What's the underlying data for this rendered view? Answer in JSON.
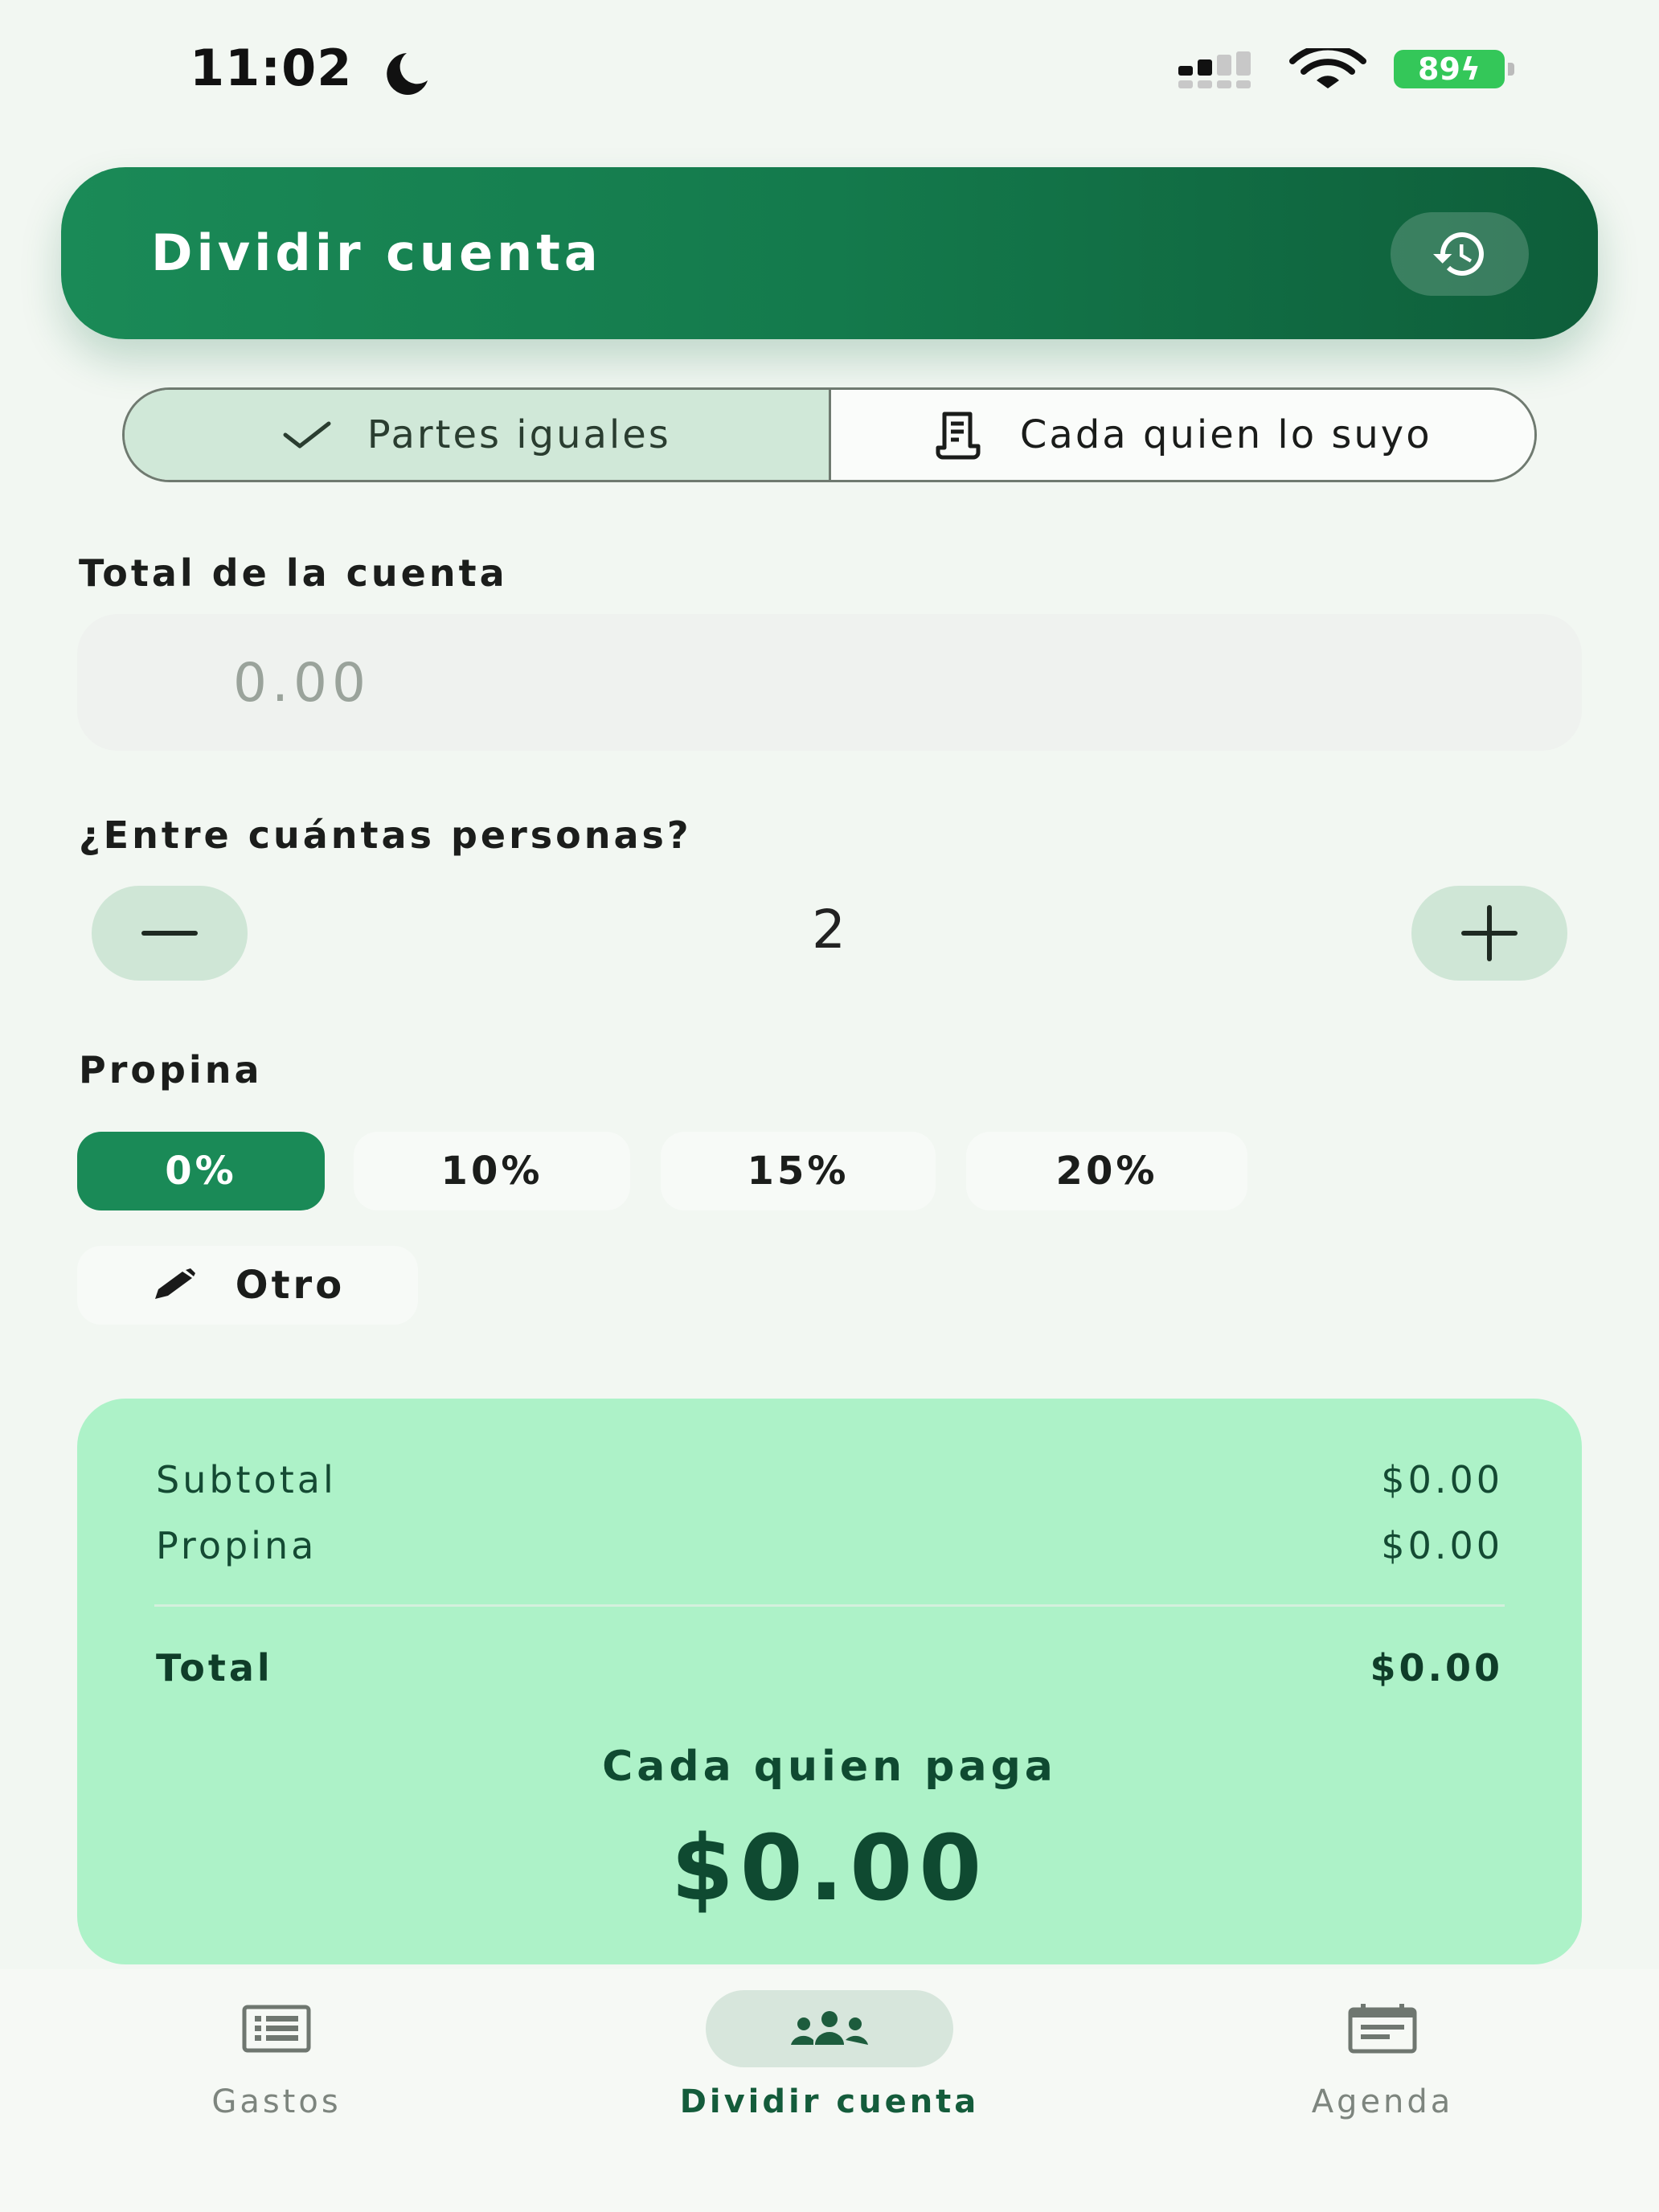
{
  "status_bar": {
    "time": "11:02",
    "battery": "89",
    "icons": [
      "moon-icon",
      "cellular-signal-icon",
      "wifi-icon",
      "battery-charging-icon"
    ]
  },
  "header": {
    "title": "Dividir cuenta",
    "history_icon": "history-icon",
    "gradient_start": "#1a8a57",
    "gradient_end": "#0e5e3a"
  },
  "modes": {
    "equal_label": "Partes iguales",
    "itemized_label": "Cada quien lo suyo",
    "selected": "equal"
  },
  "total_section": {
    "label": "Total de la cuenta",
    "placeholder": "0.00",
    "value": ""
  },
  "people_section": {
    "label": "¿Entre cuántas personas?",
    "count": "2"
  },
  "tip_section": {
    "label": "Propina",
    "options": [
      {
        "label": "0%",
        "selected": true
      },
      {
        "label": "10%",
        "selected": false
      },
      {
        "label": "15%",
        "selected": false
      },
      {
        "label": "20%",
        "selected": false
      }
    ],
    "other_label": "Otro"
  },
  "summary": {
    "subtotal_label": "Subtotal",
    "subtotal_value": "$0.00",
    "tip_label": "Propina",
    "tip_value": "$0.00",
    "total_label": "Total",
    "total_value": "$0.00",
    "each_label": "Cada quien paga",
    "each_value": "$0.00"
  },
  "nav": {
    "items": [
      {
        "label": "Gastos",
        "icon": "list-icon",
        "active": false
      },
      {
        "label": "Dividir cuenta",
        "icon": "group-icon",
        "active": true
      },
      {
        "label": "Agenda",
        "icon": "calendar-icon",
        "active": false
      }
    ]
  },
  "colors": {
    "accent": "#1a8a57",
    "background": "#f2f7f2",
    "summary_card": "#adf2c8",
    "selected_segment": "#d0e8d8"
  }
}
